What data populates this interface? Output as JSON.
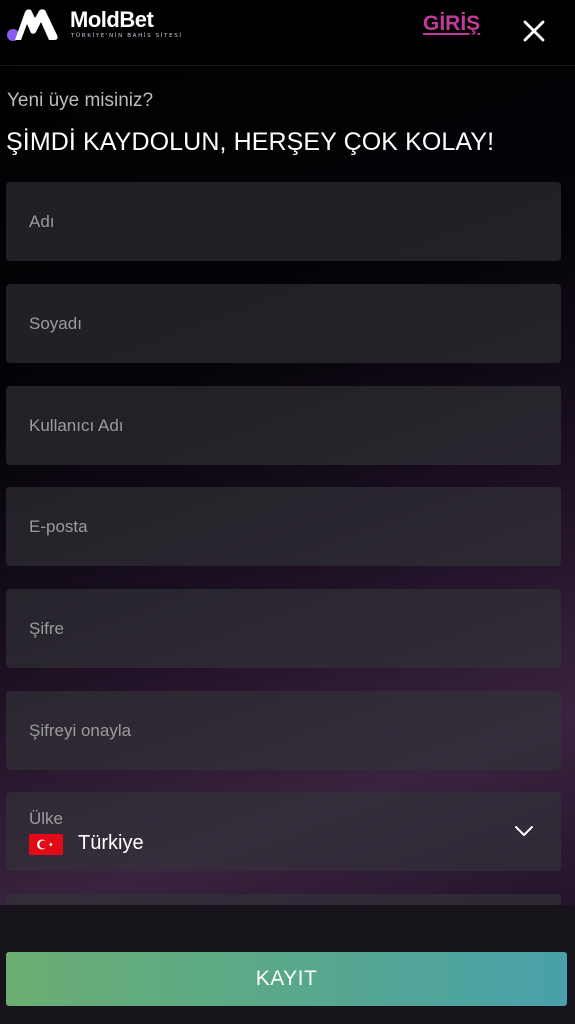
{
  "header": {
    "brand": "MoldBet",
    "tagline": "TÜRKİYE'NİN BAHİS SİTESİ",
    "login_label": "GİRİŞ",
    "close_icon": "close-icon"
  },
  "intro": {
    "subtitle": "Yeni üye misiniz?",
    "title": "ŞİMDİ KAYDOLUN, HERŞEY ÇOK KOLAY!"
  },
  "form": {
    "first_name_placeholder": "Adı",
    "last_name_placeholder": "Soyadı",
    "username_placeholder": "Kullanıcı Adı",
    "email_placeholder": "E-posta",
    "password_placeholder": "Şifre",
    "password_confirm_placeholder": "Şifreyi onayla",
    "country": {
      "label": "Ülke",
      "value": "Türkiye",
      "flag_icon": "turkey-flag-icon",
      "dropdown_icon": "chevron-down-icon"
    }
  },
  "footer": {
    "register_label": "KAYIT"
  },
  "colors": {
    "accent_link": "#c13a9b",
    "button_gradient_start": "#6cae72",
    "button_gradient_end": "#49a0aa",
    "field_background": "#343438"
  }
}
